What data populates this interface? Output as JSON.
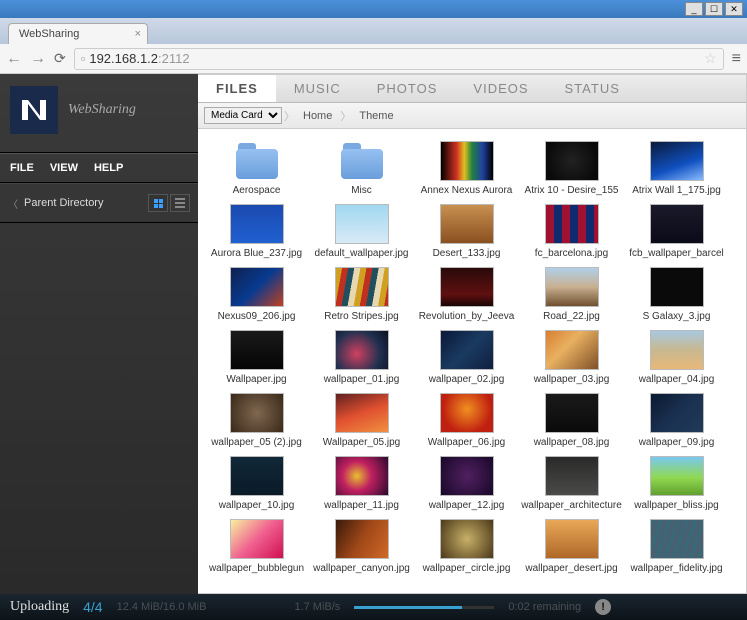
{
  "browser": {
    "tab_title": "WebSharing",
    "url_host": "192.168.1.2",
    "url_port": ":2112"
  },
  "sidebar": {
    "app_name": "WebSharing",
    "menu": {
      "file": "FILE",
      "view": "VIEW",
      "help": "HELP"
    },
    "parent_dir": "Parent Directory"
  },
  "tabs": [
    "FILES",
    "MUSIC",
    "PHOTOS",
    "VIDEOS",
    "STATUS"
  ],
  "active_tab": 0,
  "breadcrumb": {
    "source": "Media Card",
    "path": [
      "Home",
      "Theme"
    ]
  },
  "items": [
    {
      "type": "folder",
      "name": "Aerospace"
    },
    {
      "type": "folder",
      "name": "Misc"
    },
    {
      "type": "img",
      "name": "Annex Nexus Aurora",
      "bg": "linear-gradient(90deg,#000,#d03020 30%,#e0c020 45%,#208040 60%,#2040a0 80%,#000)"
    },
    {
      "type": "img",
      "name": "Atrix 10 - Desire_155",
      "bg": "radial-gradient(circle,#222 0%,#0a0a0a 80%)"
    },
    {
      "type": "img",
      "name": "Atrix Wall 1_175.jpg",
      "bg": "linear-gradient(160deg,#0a1a3a,#1050c0 60%,#88bbff)"
    },
    {
      "type": "img",
      "name": "Aurora Blue_237.jpg",
      "bg": "linear-gradient(#1a4ab0,#2060d0)"
    },
    {
      "type": "img",
      "name": "default_wallpaper.jpg",
      "bg": "linear-gradient(#a0d8f0,#d8eaf5)"
    },
    {
      "type": "img",
      "name": "Desert_133.jpg",
      "bg": "linear-gradient(#c89050,#8a5020)"
    },
    {
      "type": "img",
      "name": "fc_barcelona.jpg",
      "bg": "repeating-linear-gradient(90deg,#a01030 0 8px,#102a70 8px 16px)"
    },
    {
      "type": "img",
      "name": "fcb_wallpaper_barcel",
      "bg": "linear-gradient(#1a1a2a,#0a0a18)"
    },
    {
      "type": "img",
      "name": "Nexus09_206.jpg",
      "bg": "linear-gradient(135deg,#102050,#083a90,#c04020)"
    },
    {
      "type": "img",
      "name": "Retro Stripes.jpg",
      "bg": "repeating-linear-gradient(100deg,#d0a020 0 6px,#c03020 6px 12px,#205060 12px 18px,#e8d8b0 18px 24px)"
    },
    {
      "type": "img",
      "name": "Revolution_by_Jeeva",
      "bg": "linear-gradient(#2a0a0a,#601010 70%,#1a0505)"
    },
    {
      "type": "img",
      "name": "Road_22.jpg",
      "bg": "linear-gradient(#b0d0e8 0%,#c8b090 50%,#705030 100%)"
    },
    {
      "type": "img",
      "name": "S Galaxy_3.jpg",
      "bg": "#0a0a0a"
    },
    {
      "type": "img",
      "name": "Wallpaper.jpg",
      "bg": "linear-gradient(#1a1a1a,#050505)"
    },
    {
      "type": "img",
      "name": "wallpaper_01.jpg",
      "bg": "radial-gradient(circle at 40% 60%,#d04060,#203050 60%,#0a1020)"
    },
    {
      "type": "img",
      "name": "wallpaper_02.jpg",
      "bg": "linear-gradient(135deg,#0a1838,#1a3a60,#102040)"
    },
    {
      "type": "img",
      "name": "wallpaper_03.jpg",
      "bg": "linear-gradient(135deg,#d88030,#e8b060 40%,#805028)"
    },
    {
      "type": "img",
      "name": "wallpaper_04.jpg",
      "bg": "linear-gradient(#a8c8e0,#c8b890,#e8b878)"
    },
    {
      "type": "img",
      "name": "wallpaper_05 (2).jpg",
      "bg": "radial-gradient(circle at 50% 50%,#806850,#3a2818)"
    },
    {
      "type": "img",
      "name": "Wallpaper_05.jpg",
      "bg": "linear-gradient(160deg,#602020,#e05030,#f09040)"
    },
    {
      "type": "img",
      "name": "Wallpaper_06.jpg",
      "bg": "radial-gradient(circle at 50% 40%,#f09020,#c02010 70%)"
    },
    {
      "type": "img",
      "name": "wallpaper_08.jpg",
      "bg": "linear-gradient(#1a1a1a,#0a0a0a)"
    },
    {
      "type": "img",
      "name": "wallpaper_09.jpg",
      "bg": "linear-gradient(135deg,#0a1a30,#1a3050,#203a58)"
    },
    {
      "type": "img",
      "name": "wallpaper_10.jpg",
      "bg": "linear-gradient(#102838,#0a1a28)"
    },
    {
      "type": "img",
      "name": "wallpaper_11.jpg",
      "bg": "radial-gradient(circle at 40% 50%,#e8c030,#c02060 40%,#2a0a30)"
    },
    {
      "type": "img",
      "name": "wallpaper_12.jpg",
      "bg": "radial-gradient(circle at 50% 50%,#502060,#180828)"
    },
    {
      "type": "img",
      "name": "wallpaper_architecture",
      "bg": "linear-gradient(#2a2a2a,#4a4a48)"
    },
    {
      "type": "img",
      "name": "wallpaper_bliss.jpg",
      "bg": "linear-gradient(#78c8f0 0%,#90d850 55%,#60a030 100%)"
    },
    {
      "type": "img",
      "name": "wallpaper_bubblegun",
      "bg": "linear-gradient(135deg,#f8f0a0,#f06090,#d01050)"
    },
    {
      "type": "img",
      "name": "wallpaper_canyon.jpg",
      "bg": "linear-gradient(120deg,#3a1a0a,#a04818,#d06828)"
    },
    {
      "type": "img",
      "name": "wallpaper_circle.jpg",
      "bg": "radial-gradient(circle at 50% 50%,#c8b068,#4a3818)"
    },
    {
      "type": "img",
      "name": "wallpaper_desert.jpg",
      "bg": "linear-gradient(#e8a858,#b06828)"
    },
    {
      "type": "img",
      "name": "wallpaper_fidelity.jpg",
      "bg": "repeating-linear-gradient(110deg,#3a6878 0 4px,#486070 4px 8px)"
    }
  ],
  "upload": {
    "label": "Uploading",
    "count": "4/4",
    "size": "12.4 MiB/16.0 MiB",
    "speed": "1.7 MiB/s",
    "remaining": "0:02 remaining",
    "progress_pct": 77
  }
}
